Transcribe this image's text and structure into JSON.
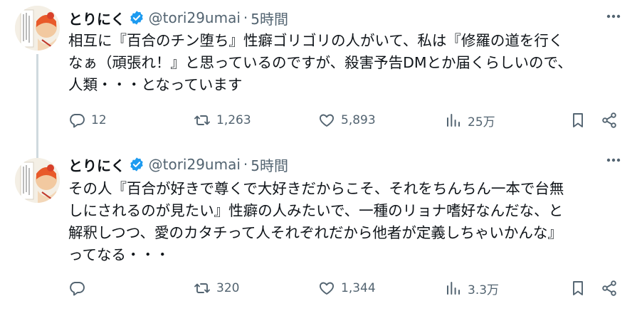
{
  "tweets": [
    {
      "author": {
        "name": "とりにく",
        "handle": "@tori29umai",
        "time": "5時間"
      },
      "text": "相互に『百合のチン堕ち』性癖ゴリゴリの人がいて、私は『修羅の道を行く\nなぁ（頑張れ！』と思っているのですが、殺害予告DMとか届くらしいので、\n人類・・・となっています",
      "stats": {
        "replies": "12",
        "retweets": "1,263",
        "likes": "5,893",
        "views": "25万"
      }
    },
    {
      "author": {
        "name": "とりにく",
        "handle": "@tori29umai",
        "time": "5時間"
      },
      "text": "その人『百合が好きで尊くで大好きだからこそ、それをちんちん一本で台無\nしにされるのが見たい』性癖の人みたいで、一種のリョナ嗜好なんだな、と\n解釈しつつ、愛のカタチって人それぞれだから他者が定義しちゃいかんな』\nってなる・・・",
      "stats": {
        "replies": "",
        "retweets": "320",
        "likes": "1,344",
        "views": "3.3万"
      }
    }
  ],
  "separator": "·",
  "colors": {
    "accent": "#1d9bf0",
    "muted": "#536471",
    "text": "#0f1419"
  },
  "icons": [
    "verified-badge-icon",
    "more-icon",
    "reply-icon",
    "retweet-icon",
    "like-icon",
    "views-icon",
    "bookmark-icon",
    "share-icon"
  ]
}
